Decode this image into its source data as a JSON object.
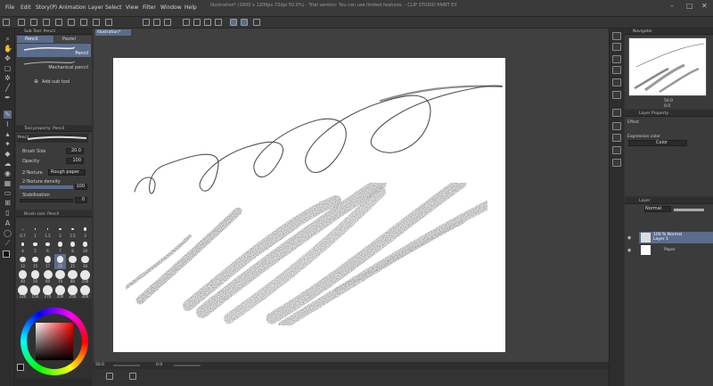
{
  "app": {
    "window_title": "Illustration* (1600 x 1200px 72dpi 50.0%)  - Trial version: You can use limited features. - CLIP STUDIO PAINT EX"
  },
  "menu": [
    "File",
    "Edit",
    "Story(P)",
    "Animation",
    "Layer",
    "Select",
    "View",
    "Filter",
    "Window",
    "Help"
  ],
  "canvas_tab": {
    "label": "Illustration*"
  },
  "sub_tool": {
    "title": "Sub Tool: Pencil",
    "tabs": [
      "Pencil",
      "Pastel"
    ],
    "items": [
      "Pencil",
      "Mechanical pencil"
    ],
    "add_label": "Add sub tool"
  },
  "tool_property": {
    "title": "Tool property: Pencil",
    "preset_name": "Pencil",
    "rows": [
      {
        "label": "Brush Size",
        "value": "20.0"
      },
      {
        "label": "Opacity",
        "value": "100"
      },
      {
        "label": "2-Texture",
        "value": "Rough paper"
      },
      {
        "label": "2-Texture density",
        "value": "100"
      },
      {
        "label": "Stabilization",
        "value": "0"
      }
    ]
  },
  "brush_size": {
    "title": "Brush size: Pencil",
    "sizes": [
      "0.7",
      "1",
      "1.5",
      "2",
      "2.5",
      "3",
      "4",
      "5",
      "6",
      "7",
      "8",
      "10",
      "12",
      "15",
      "17",
      "20",
      "25",
      "30",
      "40",
      "50",
      "60",
      "70",
      "80",
      "100",
      "120",
      "150",
      "170",
      "200",
      "250",
      "300"
    ]
  },
  "navigator": {
    "title": "Navigator",
    "zoom": "50.0",
    "rotation": "0.0"
  },
  "layer_property": {
    "title": "Layer Property",
    "effect_label": "Effect",
    "expression_label": "Expression color",
    "expression_value": "Color"
  },
  "layer_panel": {
    "title": "Layer",
    "blend_mode": "Normal",
    "opacity": "100",
    "layers": [
      {
        "name": "100 % Normal",
        "sub": "Layer 1",
        "selected": true
      },
      {
        "name": "Paper",
        "sub": "",
        "selected": false
      }
    ]
  },
  "status": {
    "zoom": "50.0",
    "rotate": "0.0"
  },
  "colors": {
    "accent": "#5b6d8c",
    "paper": "#ffffff",
    "panel": "#3b3b3b"
  }
}
